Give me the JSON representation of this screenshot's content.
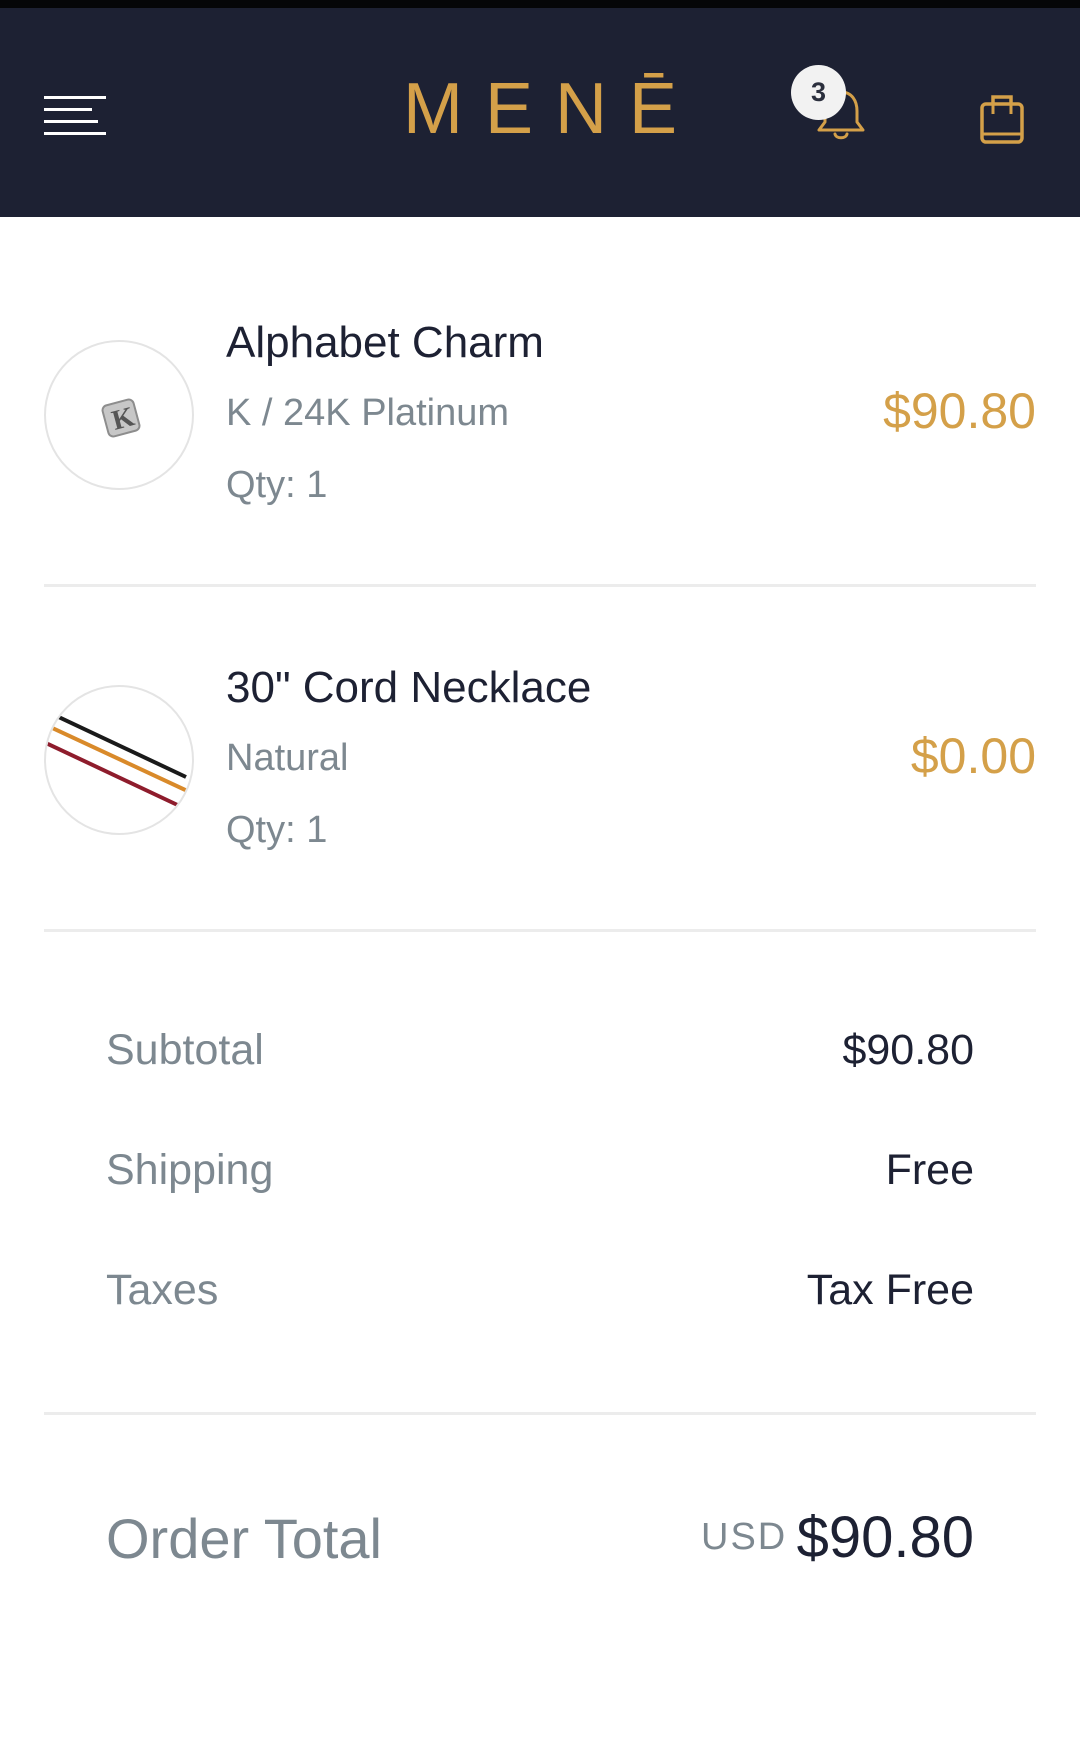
{
  "header": {
    "brand": "MENĒ",
    "notifications_count": "3",
    "icons": {
      "menu": "hamburger-menu-icon",
      "notifications": "bell-icon",
      "cart": "shopping-bag-icon"
    },
    "colors": {
      "background": "#1d2133",
      "accent": "#d4a049"
    }
  },
  "items": [
    {
      "name": "Alphabet Charm",
      "variant": "K / 24K Platinum",
      "qty": "Qty: 1",
      "price": "$90.80"
    },
    {
      "name": "30\" Cord Necklace",
      "variant": "Natural",
      "qty": "Qty: 1",
      "price": "$0.00"
    }
  ],
  "summary": {
    "subtotal_label": "Subtotal",
    "subtotal_value": "$90.80",
    "shipping_label": "Shipping",
    "shipping_value": "Free",
    "taxes_label": "Taxes",
    "taxes_value": "Tax Free"
  },
  "total": {
    "label": "Order Total",
    "currency": "USD",
    "value": "$90.80"
  }
}
